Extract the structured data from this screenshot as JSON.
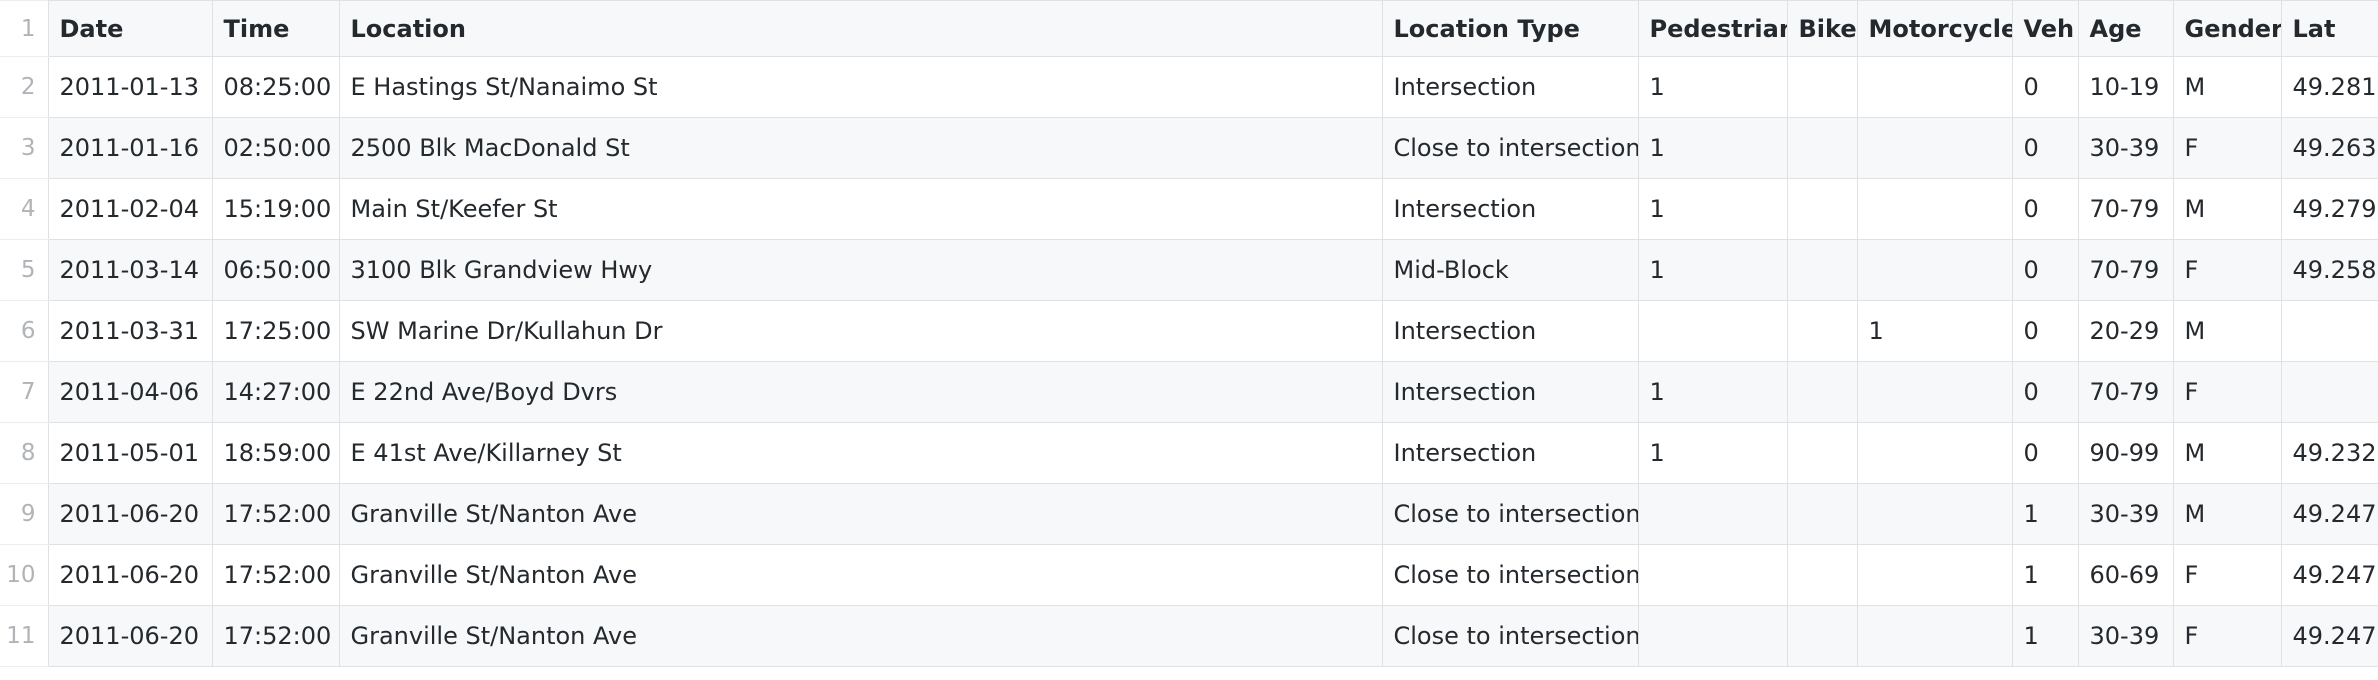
{
  "table": {
    "line_numbers": [
      "1",
      "2",
      "3",
      "4",
      "5",
      "6",
      "7",
      "8",
      "9",
      "10",
      "11"
    ],
    "headers": [
      "Date",
      "Time",
      "Location",
      "Location Type",
      "Pedestrian",
      "Bike",
      "Motorcycle",
      "Veh",
      "Age",
      "Gender",
      "Lat"
    ],
    "rows": [
      [
        "2011-01-13",
        "08:25:00",
        "E Hastings St/Nanaimo St",
        "Intersection",
        "1",
        "",
        "",
        "0",
        "10-19",
        "M",
        "49.281"
      ],
      [
        "2011-01-16",
        "02:50:00",
        "2500 Blk MacDonald St",
        "Close to intersection",
        "1",
        "",
        "",
        "0",
        "30-39",
        "F",
        "49.263"
      ],
      [
        "2011-02-04",
        "15:19:00",
        "Main St/Keefer St",
        "Intersection",
        "1",
        "",
        "",
        "0",
        "70-79",
        "M",
        "49.279"
      ],
      [
        "2011-03-14",
        "06:50:00",
        "3100 Blk Grandview Hwy",
        "Mid-Block",
        "1",
        "",
        "",
        "0",
        "70-79",
        "F",
        "49.258"
      ],
      [
        "2011-03-31",
        "17:25:00",
        "SW Marine Dr/Kullahun Dr",
        "Intersection",
        "",
        "",
        "1",
        "0",
        "20-29",
        "M",
        ""
      ],
      [
        "2011-04-06",
        "14:27:00",
        "E 22nd Ave/Boyd Dvrs",
        "Intersection",
        "1",
        "",
        "",
        "0",
        "70-79",
        "F",
        ""
      ],
      [
        "2011-05-01",
        "18:59:00",
        "E 41st Ave/Killarney St",
        "Intersection",
        "1",
        "",
        "",
        "0",
        "90-99",
        "M",
        "49.232"
      ],
      [
        "2011-06-20",
        "17:52:00",
        "Granville St/Nanton Ave",
        "Close to intersection",
        "",
        "",
        "",
        "1",
        "30-39",
        "M",
        "49.247"
      ],
      [
        "2011-06-20",
        "17:52:00",
        "Granville St/Nanton Ave",
        "Close to intersection",
        "",
        "",
        "",
        "1",
        "60-69",
        "F",
        "49.247"
      ],
      [
        "2011-06-20",
        "17:52:00",
        "Granville St/Nanton Ave",
        "Close to intersection",
        "",
        "",
        "",
        "1",
        "30-39",
        "F",
        "49.247"
      ]
    ]
  }
}
